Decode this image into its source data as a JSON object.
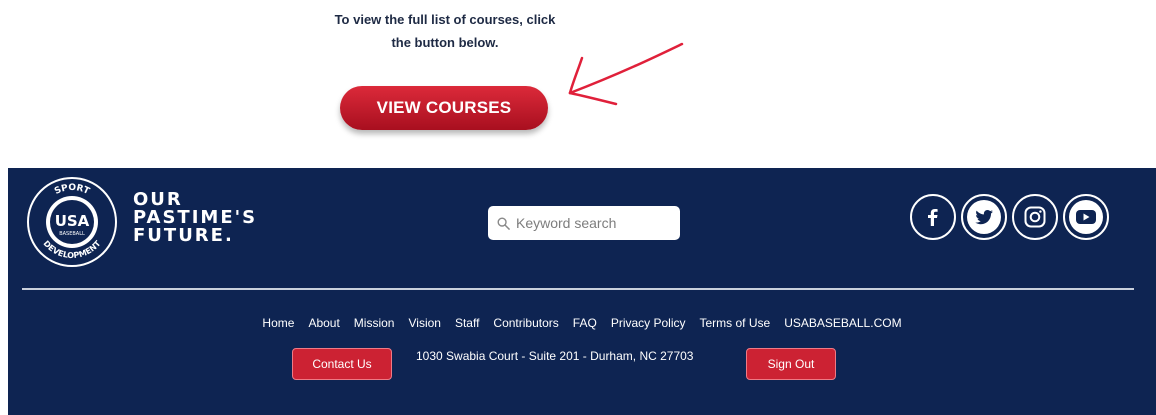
{
  "intro": {
    "line1": "To view the full list of courses, click",
    "line2": "the button below."
  },
  "cta": {
    "label": "VIEW COURSES"
  },
  "brand": {
    "seal_top": "SPORT",
    "seal_bottom": "DEVELOPMENT",
    "seal_center": "USA",
    "seal_sub": "BASEBALL",
    "wordmark_line1": "OUR",
    "wordmark_line2": "PASTIME'S",
    "wordmark_line3": "FUTURE."
  },
  "search": {
    "placeholder": "Keyword search"
  },
  "social": [
    {
      "name": "facebook-icon"
    },
    {
      "name": "twitter-icon"
    },
    {
      "name": "instagram-icon"
    },
    {
      "name": "youtube-icon"
    }
  ],
  "nav": {
    "items": [
      "Home",
      "About",
      "Mission",
      "Vision",
      "Staff",
      "Contributors",
      "FAQ",
      "Privacy Policy",
      "Terms of Use",
      "USABASEBALL.COM"
    ]
  },
  "footer": {
    "contact_label": "Contact Us",
    "address": "1030 Swabia Court - Suite 201 - Durham, NC 27703",
    "signout_label": "Sign Out"
  },
  "colors": {
    "footer_bg": "#0e2452",
    "accent_red": "#cc2233",
    "annotation_red": "#e0203a"
  }
}
